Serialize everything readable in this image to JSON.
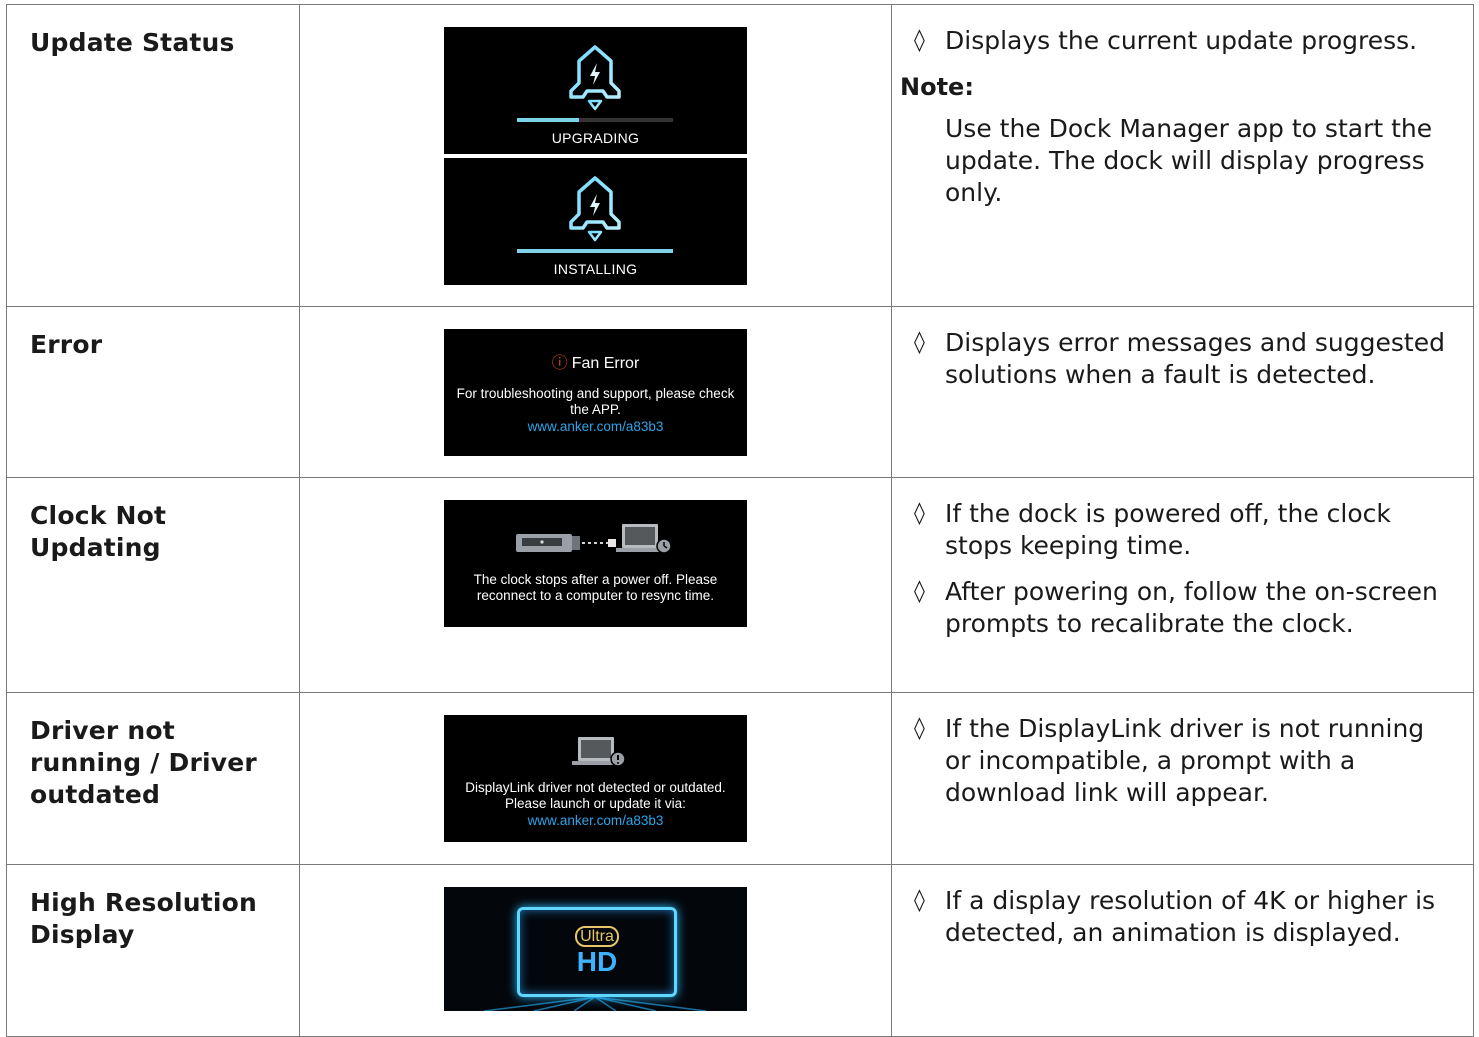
{
  "rows": [
    {
      "label": "Update Status",
      "bullets": [
        "Displays the current update progress."
      ],
      "note_title": "Note:",
      "note_text": "Use the Dock Manager app to start the update. The dock will display progress only.",
      "screens": [
        {
          "label": "UPGRADING",
          "progress": 0.4
        },
        {
          "label": "INSTALLING",
          "progress": 1.0
        }
      ]
    },
    {
      "label": "Error",
      "bullets": [
        "Displays error messages and suggested solutions when a fault is detected."
      ],
      "screen": {
        "icon": "alert-circle-icon",
        "title": "Fan Error",
        "message": "For troubleshooting and support, please check the APP.",
        "link": "www.anker.com/a83b3"
      }
    },
    {
      "label": "Clock Not Updating",
      "bullets": [
        "If the dock is powered off, the clock stops keeping time.",
        "After powering on, follow the on-screen prompts to recalibrate the clock."
      ],
      "screen": {
        "message": "The clock stops after a power off. Please reconnect to a computer to resync time."
      }
    },
    {
      "label": "Driver not running / Driver outdated",
      "bullets": [
        "If the DisplayLink driver is not running or incompatible, a prompt with a download link will appear."
      ],
      "screen": {
        "message": "DisplayLink driver not detected or outdated. Please launch or update it via:",
        "link": "www.anker.com/a83b3"
      }
    },
    {
      "label": "High Resolution Display",
      "bullets": [
        "If a display resolution of 4K or higher is detected, an animation is displayed."
      ],
      "screen": {
        "badge_top": "Ultra",
        "badge_main": "HD"
      }
    }
  ],
  "bullet_mark": "◊",
  "colors": {
    "screen_bg": "#000000",
    "accent_cyan": "#7ed3e8",
    "link_blue": "#2ea4ea",
    "error_red": "#e8452c"
  }
}
